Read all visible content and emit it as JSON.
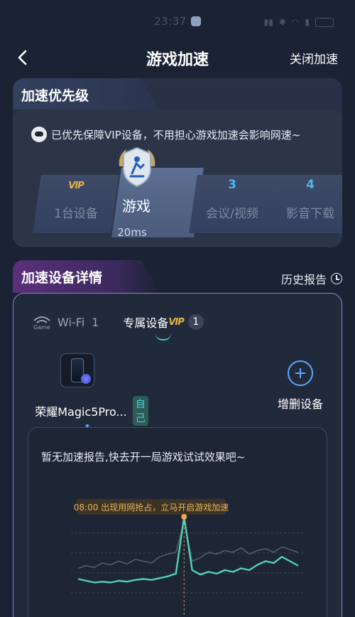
{
  "status_bar": {
    "time": "23:37"
  },
  "nav": {
    "title": "游戏加速",
    "close_label": "关闭加速"
  },
  "priority": {
    "section_title": "加速优先级",
    "notice": "已优先保障VIP设备，不用担心游戏加速会影响网速~",
    "levels": [
      {
        "num": "VIP",
        "label": "1台设备"
      },
      {
        "num": "",
        "label": "游戏"
      },
      {
        "num": "3",
        "label": "会议/视频"
      },
      {
        "num": "4",
        "label": "影音下载"
      }
    ],
    "selected_latency": "20ms"
  },
  "details": {
    "section_title": "加速设备详情",
    "history_label": "历史报告",
    "tabs": {
      "wifi_label": "Wi-Fi",
      "wifi_count": "1",
      "exclusive_label": "专属设备",
      "exclusive_vip": "VIP",
      "exclusive_count": "1"
    },
    "device": {
      "name": "荣耀Magic5Pro...",
      "tag": "自己"
    },
    "add_label": "增删设备",
    "report": {
      "empty_text": "暂无加速报告,快去开一局游戏试试效果吧~",
      "callout": "08:00 出现用网抢占，立马开启游戏加速"
    }
  },
  "colors": {
    "accent_teal": "#4fd2c8",
    "accent_gold": "#e1b449",
    "accent_blue": "#5aa7ff"
  },
  "chart_data": {
    "type": "line",
    "series": [
      {
        "values": [
          0.42,
          0.45,
          0.43,
          0.48,
          0.46,
          0.5,
          0.47,
          0.52,
          0.5,
          0.48,
          0.55,
          0.58,
          0.6,
          0.95,
          0.5,
          0.54,
          0.6,
          0.58,
          0.62,
          0.6,
          0.65,
          0.58,
          0.62,
          0.64,
          0.6,
          0.66,
          0.63,
          0.6
        ]
      },
      {
        "values": [
          0.3,
          0.28,
          0.26,
          0.27,
          0.26,
          0.28,
          0.27,
          0.29,
          0.3,
          0.29,
          0.31,
          0.33,
          0.36,
          1.0,
          0.4,
          0.35,
          0.38,
          0.36,
          0.4,
          0.38,
          0.42,
          0.4,
          0.46,
          0.5,
          0.48,
          0.55,
          0.5,
          0.45
        ]
      }
    ],
    "highlight_index": 13,
    "ylim": [
      0,
      1.2
    ]
  }
}
